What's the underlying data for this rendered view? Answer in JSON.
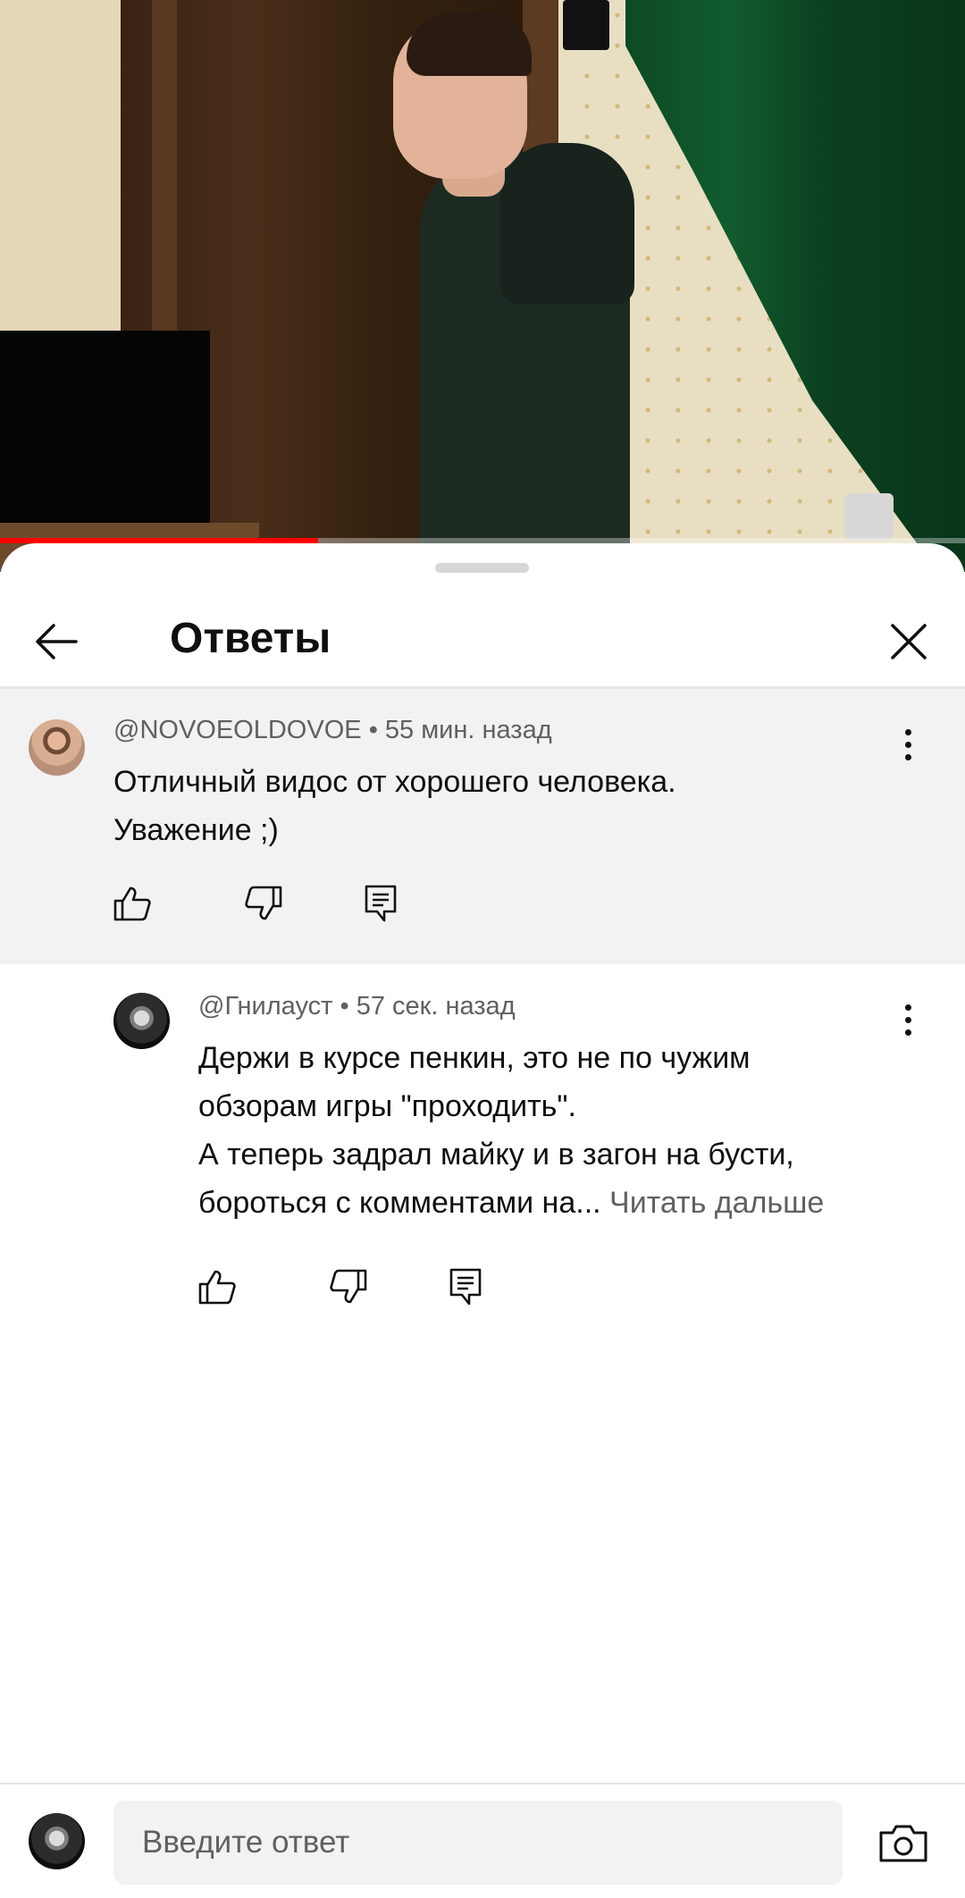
{
  "video": {
    "progress": 0.33
  },
  "panel": {
    "title": "Ответы"
  },
  "parent_comment": {
    "author": "@NOVOEOLDOVOE",
    "time": "55 мин. назад",
    "line1": "Отличный видос от хорошего человека.",
    "line2": "Уважение ;)"
  },
  "reply": {
    "author": "@Гнилауст",
    "time": "57 сек. назад",
    "line1": "Держи в курсе пенкин, это не по чужим",
    "line2": "обзорам игры \"проходить\".",
    "line3": "А теперь задрал майку и в загон на бусти,",
    "line4": "бороться с комментами на...",
    "read_more": "Читать дальше"
  },
  "composer": {
    "placeholder": "Введите ответ"
  },
  "meta_separator": "•",
  "icons": {
    "back": "arrow-left-icon",
    "close": "close-icon",
    "more": "more-vert-icon",
    "like": "thumb-up-icon",
    "dislike": "thumb-down-icon",
    "reply": "comment-reply-icon",
    "camera": "camera-icon"
  },
  "colors": {
    "accent": "#ff0000",
    "text_primary": "#0f0f0f",
    "text_secondary": "#606060",
    "highlight_bg": "#f2f2f2"
  }
}
